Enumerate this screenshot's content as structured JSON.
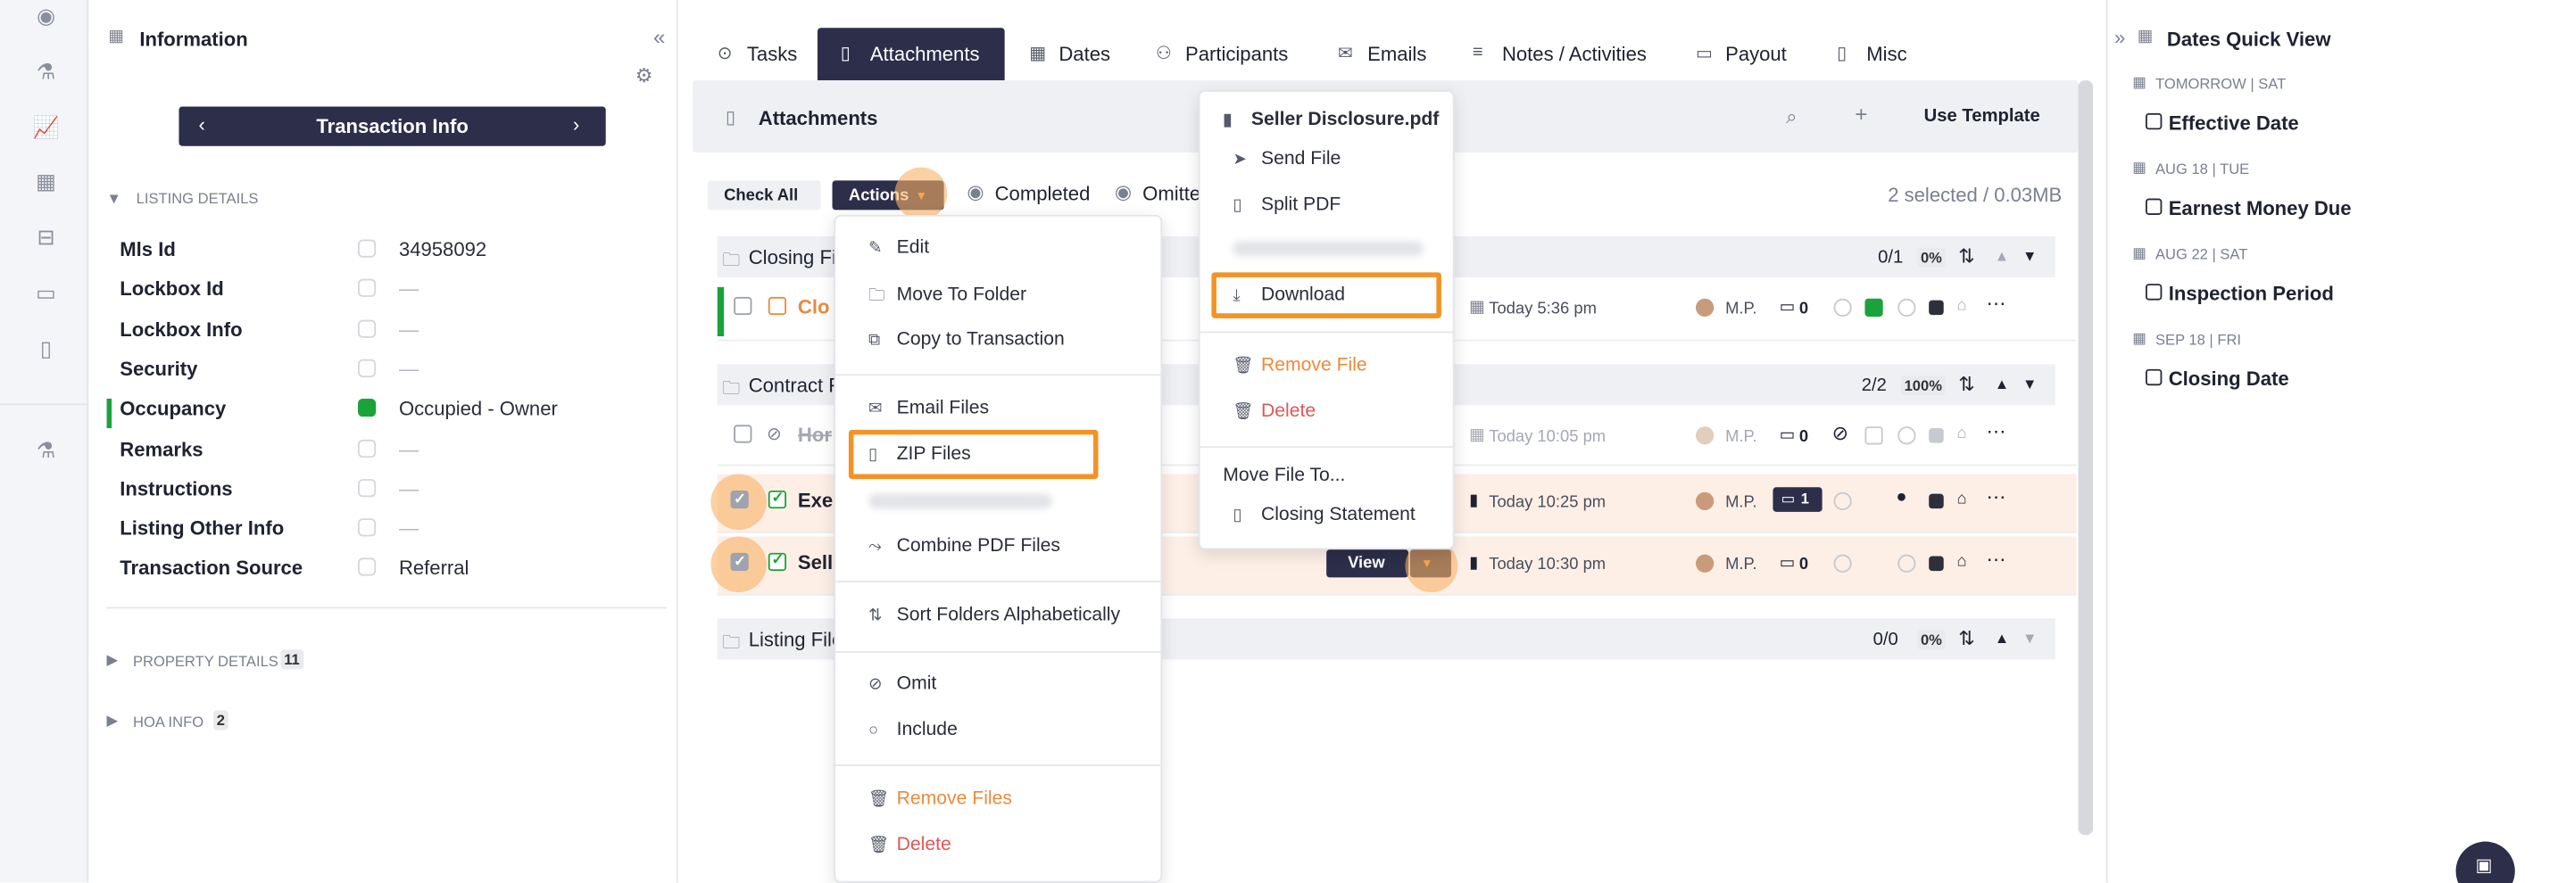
{
  "rail_icons": [
    "target-icon",
    "flask-icon",
    "chart-icon",
    "calendar-icon",
    "inbox-icon",
    "card-icon",
    "document-icon",
    "beaker-icon"
  ],
  "info": {
    "title": "Information",
    "nav_title": "Transaction Info",
    "listing_section": "LISTING DETAILS",
    "fields": [
      {
        "label": "Mls Id",
        "value": "34958092",
        "status": "empty"
      },
      {
        "label": "Lockbox Id",
        "value": "—",
        "status": "empty"
      },
      {
        "label": "Lockbox Info",
        "value": "—",
        "status": "empty"
      },
      {
        "label": "Security",
        "value": "—",
        "status": "empty"
      },
      {
        "label": "Occupancy",
        "value": "Occupied - Owner",
        "status": "green"
      },
      {
        "label": "Remarks",
        "value": "—",
        "status": "empty"
      },
      {
        "label": "Instructions",
        "value": "—",
        "status": "empty"
      },
      {
        "label": "Listing Other Info",
        "value": "—",
        "status": "empty"
      },
      {
        "label": "Transaction Source",
        "value": "Referral",
        "status": "empty"
      }
    ],
    "property_section": "PROPERTY DETAILS",
    "property_count": "11",
    "hoa_section": "HOA INFO",
    "hoa_count": "2"
  },
  "tabs": [
    {
      "label": "Tasks",
      "icon": "check-circle-icon"
    },
    {
      "label": "Attachments",
      "icon": "file-icon",
      "active": true
    },
    {
      "label": "Dates",
      "icon": "calendar-icon"
    },
    {
      "label": "Participants",
      "icon": "people-icon"
    },
    {
      "label": "Emails",
      "icon": "mail-icon"
    },
    {
      "label": "Notes / Activities",
      "icon": "list-icon"
    },
    {
      "label": "Payout",
      "icon": "money-icon"
    },
    {
      "label": "Misc",
      "icon": "clipboard-icon"
    }
  ],
  "attachments": {
    "title": "Attachments",
    "use_template": "Use Template",
    "check_all": "Check All",
    "actions": "Actions",
    "completed": "Completed",
    "omitted": "Omitte",
    "selected": "2 selected / 0.03MB",
    "folders": [
      {
        "name": "Closing Fi",
        "count": "0/1",
        "pct": "0%"
      },
      {
        "name": "Contract F",
        "count": "2/2",
        "pct": "100%"
      },
      {
        "name": "Listing File",
        "count": "0/0",
        "pct": "0%"
      }
    ],
    "files": [
      {
        "name": "Clo",
        "date": "Today 5:36 pm",
        "initials": "M.P.",
        "comments": "0"
      },
      {
        "name": "Hor",
        "date": "Today 10:05 pm",
        "initials": "M.P.",
        "comments": "0"
      },
      {
        "name": "Exe",
        "date": "Today 10:25 pm",
        "initials": "M.P.",
        "comments": "1"
      },
      {
        "name": "Sell",
        "date": "Today 10:30 pm",
        "initials": "M.P.",
        "comments": "0"
      }
    ],
    "view_label": "View"
  },
  "actions_menu": {
    "items": [
      "Edit",
      "Move To Folder",
      "Copy to Transaction",
      "Email Files",
      "ZIP Files",
      "Combine PDF Files",
      "Sort Folders Alphabetically",
      "Omit",
      "Include",
      "Remove Files",
      "Delete"
    ]
  },
  "file_menu": {
    "filename": "Seller Disclosure.pdf",
    "send": "Send File",
    "split": "Split PDF",
    "download": "Download",
    "remove": "Remove File",
    "delete": "Delete",
    "move_to": "Move File To...",
    "folder": "Closing Statement"
  },
  "dates_quick": {
    "title": "Dates Quick View",
    "items": [
      {
        "when": "TOMORROW | SAT",
        "name": "Effective Date"
      },
      {
        "when": "AUG 18 | TUE",
        "name": "Earnest Money Due"
      },
      {
        "when": "AUG 22 | SAT",
        "name": "Inspection Period"
      },
      {
        "when": "SEP 18 | FRI",
        "name": "Closing Date"
      }
    ]
  },
  "colors": {
    "navy": "#2c2e4a",
    "highlight": "#f39325",
    "green": "#1aa33b",
    "red": "#e05757",
    "orange": "#ec8a3a"
  }
}
